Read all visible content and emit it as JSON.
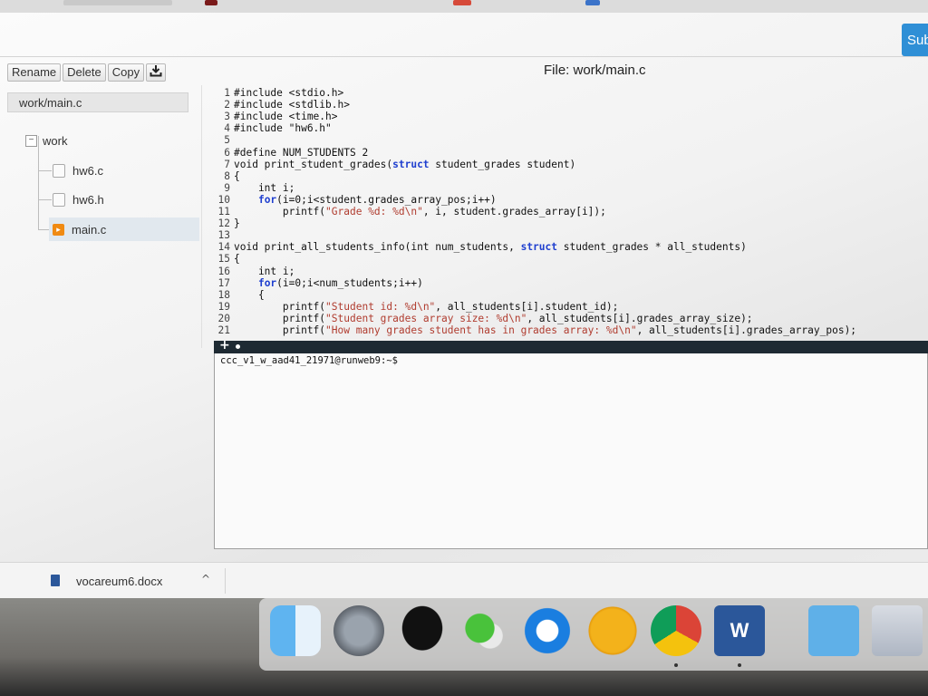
{
  "browser": {
    "submit_label": "Sub"
  },
  "toolbar": {
    "rename_label": "Rename",
    "delete_label": "Delete",
    "copy_label": "Copy",
    "download_icon": "download-icon"
  },
  "editor_title": "File: work/main.c",
  "sidebar": {
    "path": "work/main.c",
    "folder": {
      "label": "work",
      "expander": "−"
    },
    "files": [
      {
        "label": "hw6.c",
        "icon": "file-icon"
      },
      {
        "label": "hw6.h",
        "icon": "file-icon"
      },
      {
        "label": "main.c",
        "icon": "c-file-icon",
        "selected": true
      }
    ]
  },
  "code": {
    "lines": [
      {
        "n": "1",
        "pre": "#include <stdio.h>"
      },
      {
        "n": "2",
        "pre": "#include <stdlib.h>"
      },
      {
        "n": "3",
        "pre": "#include <time.h>"
      },
      {
        "n": "4",
        "pre": "#include \"hw6.h\""
      },
      {
        "n": "5",
        "pre": ""
      },
      {
        "n": "6",
        "pre": "#define NUM_STUDENTS 2"
      },
      {
        "n": "7",
        "pre": "void print_student_grades(",
        "kw": "struct",
        "post": " student_grades student)"
      },
      {
        "n": "8",
        "pre": "{"
      },
      {
        "n": "9",
        "pre": "    int i;"
      },
      {
        "n": "10",
        "pre": "    ",
        "kw": "for",
        "post": "(i=0;i<student.grades_array_pos;i++)"
      },
      {
        "n": "11",
        "pre": "        printf(",
        "str": "\"Grade %d: %d\\n\"",
        "post": ", i, student.grades_array[i]);"
      },
      {
        "n": "12",
        "pre": "}"
      },
      {
        "n": "13",
        "pre": ""
      },
      {
        "n": "14",
        "pre": "void print_all_students_info(int num_students, ",
        "kw": "struct",
        "post": " student_grades * all_students)"
      },
      {
        "n": "15",
        "pre": "{"
      },
      {
        "n": "16",
        "pre": "    int i;"
      },
      {
        "n": "17",
        "pre": "    ",
        "kw": "for",
        "post": "(i=0;i<num_students;i++)"
      },
      {
        "n": "18",
        "pre": "    {"
      },
      {
        "n": "19",
        "pre": "        printf(",
        "str": "\"Student id: %d\\n\"",
        "post": ", all_students[i].student_id);"
      },
      {
        "n": "20",
        "pre": "        printf(",
        "str": "\"Student grades array size: %d\\n\"",
        "post": ", all_students[i].grades_array_size);"
      },
      {
        "n": "21",
        "pre": "        printf(",
        "str": "\"How many grades student has in grades array: %d\\n\"",
        "post": ", all_students[i].grades_array_pos);"
      }
    ]
  },
  "terminal": {
    "add_tab_label": "+",
    "prompt": "ccc_v1_w_aad41_21971@runweb9:~$"
  },
  "downloads": {
    "file_name": "vocareum6.docx",
    "chevron": "^",
    "file_icon": "word-doc-icon"
  },
  "dock": {
    "apps": [
      "finder-icon",
      "launchpad-icon",
      "qq-icon",
      "wechat-icon",
      "quicktime-icon",
      "music-icon",
      "chrome-icon",
      "word-icon",
      "downloads-folder-icon",
      "word-document-icon"
    ],
    "word_letter": "W"
  },
  "colors": {
    "submit": "#2f8fd6",
    "keyword": "#1f3fcf",
    "string": "#b03c2f",
    "terminal_bar": "#1e2a33",
    "c_badge": "#f08a12"
  }
}
